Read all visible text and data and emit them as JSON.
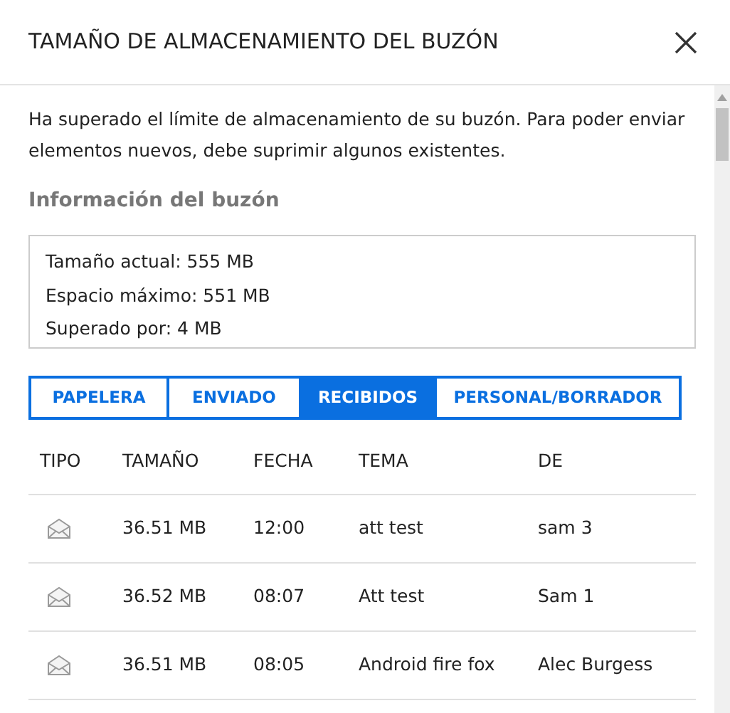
{
  "dialog": {
    "title": "TAMAÑO DE ALMACENAMIENTO DEL BUZÓN"
  },
  "message": "Ha superado el límite de almacenamiento de su buzón. Para poder enviar elementos nuevos, debe suprimir algunos existentes.",
  "info": {
    "heading": "Información del buzón",
    "lines": [
      "Tamaño actual: 555 MB",
      "Espacio máximo: 551 MB",
      "Superado por: 4 MB"
    ]
  },
  "tabs": [
    {
      "label": "PAPELERA",
      "selected": false
    },
    {
      "label": "ENVIADO",
      "selected": false
    },
    {
      "label": "RECIBIDOS",
      "selected": true
    },
    {
      "label": "PERSONAL/BORRADOR",
      "selected": false
    }
  ],
  "table": {
    "columns": [
      "TIPO",
      "TAMAÑO",
      "FECHA",
      "TEMA",
      "DE"
    ],
    "rows": [
      {
        "size": "36.51 MB",
        "date": "12:00",
        "subject": "att test",
        "from": "sam 3"
      },
      {
        "size": "36.52 MB",
        "date": "08:07",
        "subject": "Att test",
        "from": "Sam 1"
      },
      {
        "size": "36.51 MB",
        "date": "08:05",
        "subject": "Android fire fox",
        "from": "Alec Burgess"
      }
    ]
  }
}
